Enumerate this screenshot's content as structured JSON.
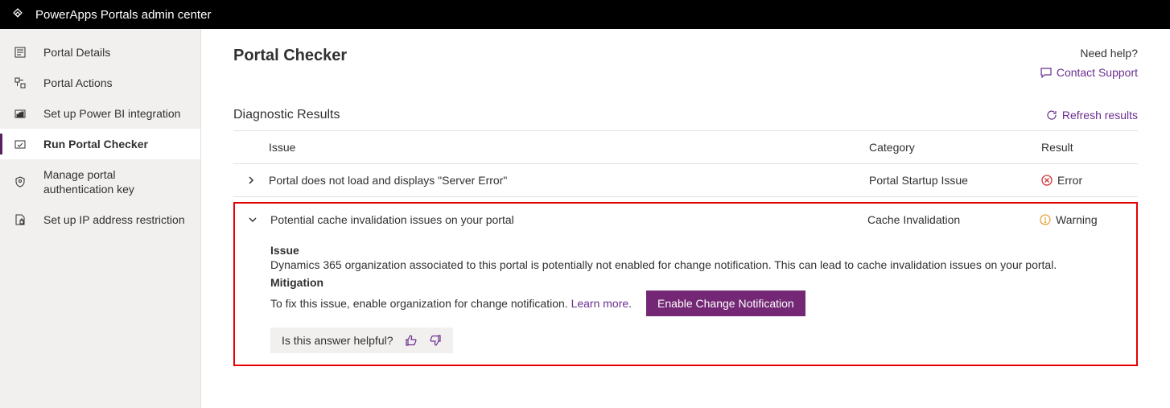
{
  "header": {
    "title": "PowerApps Portals admin center"
  },
  "sidebar": {
    "items": [
      {
        "label": "Portal Details"
      },
      {
        "label": "Portal Actions"
      },
      {
        "label": "Set up Power BI integration"
      },
      {
        "label": "Run Portal Checker"
      },
      {
        "label": "Manage portal authentication key"
      },
      {
        "label": "Set up IP address restriction"
      }
    ]
  },
  "page": {
    "title": "Portal Checker",
    "need_help": "Need help?",
    "contact_support": "Contact Support",
    "section_title": "Diagnostic Results",
    "refresh": "Refresh results",
    "columns": {
      "issue": "Issue",
      "category": "Category",
      "result": "Result"
    },
    "rows": [
      {
        "issue": "Portal does not load and displays \"Server Error\"",
        "category": "Portal Startup Issue",
        "result": "Error"
      },
      {
        "issue": "Potential cache invalidation issues on your portal",
        "category": "Cache Invalidation",
        "result": "Warning",
        "detail": {
          "issue_h": "Issue",
          "issue_t": "Dynamics 365 organization associated to this portal is potentially not enabled for change notification. This can lead to cache invalidation issues on your portal.",
          "mitig_h": "Mitigation",
          "mitig_t": "To fix this issue, enable organization for change notification.",
          "learn_more": "Learn more",
          "button": "Enable Change Notification",
          "feedback_q": "Is this answer helpful?"
        }
      }
    ]
  }
}
